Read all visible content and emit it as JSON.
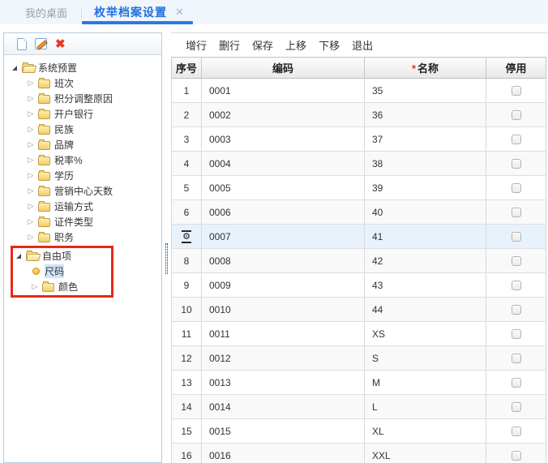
{
  "tabs": {
    "inactive_label": "我的桌面",
    "active_label": "枚举档案设置",
    "close_glyph": "✕"
  },
  "left_toolbar": {
    "icons": [
      "new-document-icon",
      "edit-icon",
      "delete-icon"
    ],
    "delete_glyph": "✖"
  },
  "tree": {
    "items": [
      {
        "label": "系统预置",
        "state": "expanded",
        "icon": "open-folder-icon",
        "level": 0
      },
      {
        "label": "班次",
        "state": "collapsed",
        "icon": "folder-icon",
        "level": 1
      },
      {
        "label": "积分调整原因",
        "state": "collapsed",
        "icon": "folder-icon",
        "level": 1
      },
      {
        "label": "开户银行",
        "state": "collapsed",
        "icon": "folder-icon",
        "level": 1
      },
      {
        "label": "民族",
        "state": "collapsed",
        "icon": "folder-icon",
        "level": 1
      },
      {
        "label": "品牌",
        "state": "collapsed",
        "icon": "folder-icon",
        "level": 1
      },
      {
        "label": "税率%",
        "state": "collapsed",
        "icon": "folder-icon",
        "level": 1
      },
      {
        "label": "学历",
        "state": "collapsed",
        "icon": "folder-icon",
        "level": 1
      },
      {
        "label": "营销中心天数",
        "state": "collapsed",
        "icon": "folder-icon",
        "level": 1
      },
      {
        "label": "运输方式",
        "state": "collapsed",
        "icon": "folder-icon",
        "level": 1
      },
      {
        "label": "证件类型",
        "state": "collapsed",
        "icon": "folder-icon",
        "level": 1
      },
      {
        "label": "职务",
        "state": "collapsed",
        "icon": "folder-icon",
        "level": 1
      },
      {
        "label": "自由项",
        "state": "expanded",
        "icon": "open-folder-icon",
        "level": 0,
        "annotated": true
      },
      {
        "label": "尺码",
        "state": "leaf",
        "icon": "orange-dot-icon",
        "level": 1,
        "selected": true,
        "annotated": true
      },
      {
        "label": "颜色",
        "state": "collapsed",
        "icon": "folder-icon",
        "level": 1,
        "annotated": true
      }
    ],
    "collapsed_glyph": "▷",
    "annotation_color": "#e4291b"
  },
  "toolbar": {
    "buttons": [
      "增行",
      "删行",
      "保存",
      "上移",
      "下移",
      "退出"
    ]
  },
  "table": {
    "columns": [
      "序号",
      "编码",
      "名称",
      "停用"
    ],
    "required_mark": "*",
    "gear_glyph": "⚙",
    "rows": [
      {
        "index": "1",
        "code": "0001",
        "name": "35",
        "disabled": false
      },
      {
        "index": "2",
        "code": "0002",
        "name": "36",
        "disabled": false
      },
      {
        "index": "3",
        "code": "0003",
        "name": "37",
        "disabled": false
      },
      {
        "index": "4",
        "code": "0004",
        "name": "38",
        "disabled": false
      },
      {
        "index": "5",
        "code": "0005",
        "name": "39",
        "disabled": false
      },
      {
        "index": "6",
        "code": "0006",
        "name": "40",
        "disabled": false
      },
      {
        "index": "",
        "indicator": "current-row-gear-icon",
        "code": "0007",
        "name": "41",
        "disabled": false,
        "current": true
      },
      {
        "index": "8",
        "code": "0008",
        "name": "42",
        "disabled": false
      },
      {
        "index": "9",
        "code": "0009",
        "name": "43",
        "disabled": false
      },
      {
        "index": "10",
        "code": "0010",
        "name": "44",
        "disabled": false
      },
      {
        "index": "11",
        "code": "0011",
        "name": "XS",
        "disabled": false
      },
      {
        "index": "12",
        "code": "0012",
        "name": "S",
        "disabled": false
      },
      {
        "index": "13",
        "code": "0013",
        "name": "M",
        "disabled": false
      },
      {
        "index": "14",
        "code": "0014",
        "name": "L",
        "disabled": false
      },
      {
        "index": "15",
        "code": "0015",
        "name": "XL",
        "disabled": false
      },
      {
        "index": "16",
        "code": "0016",
        "name": "XXL",
        "disabled": false
      }
    ]
  },
  "colors": {
    "accent_blue": "#2b7ae2",
    "tabbar_bg": "#f1f6fc",
    "row_highlight": "#e8f2fc",
    "annotation_red": "#e4291b",
    "required_red": "#e53324"
  }
}
